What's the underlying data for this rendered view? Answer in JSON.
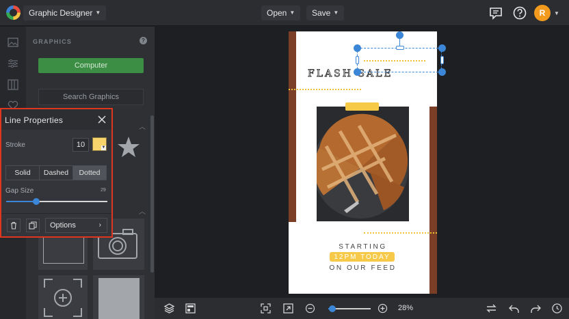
{
  "topbar": {
    "app_menu_label": "Graphic Designer",
    "open_label": "Open",
    "save_label": "Save",
    "avatar_initial": "R"
  },
  "panel": {
    "title": "GRAPHICS",
    "computer_button": "Computer",
    "search_button": "Search Graphics"
  },
  "line_properties": {
    "title": "Line Properties",
    "stroke_label": "Stroke",
    "stroke_value": "10",
    "stroke_color": "#f7d56c",
    "styles": [
      "Solid",
      "Dashed",
      "Dotted"
    ],
    "active_style": "Dotted",
    "gap_label": "Gap Size",
    "gap_value": "29",
    "gap_fraction": 0.3,
    "options_label": "Options"
  },
  "canvas": {
    "headline": "FLASH SALE",
    "line1": "STARTING",
    "line2": "12PM TODAY",
    "line3": "ON OUR FEED",
    "accent": "#f6c946",
    "bar_color": "#7b3f28"
  },
  "bottombar": {
    "zoom_label": "28%",
    "zoom_fraction": 0.1
  }
}
